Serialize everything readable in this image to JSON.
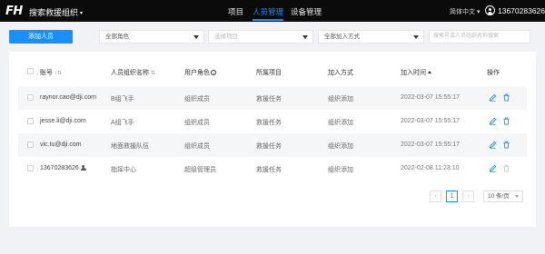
{
  "header": {
    "logo": "FH",
    "org_name": "搜索救援组织",
    "org_caret": "▾",
    "nav": [
      {
        "label": "项目",
        "active": false
      },
      {
        "label": "人员管理",
        "active": true
      },
      {
        "label": "设备管理",
        "active": false
      }
    ],
    "language": "简体中文 ▾",
    "user_phone": "13670283626"
  },
  "toolbar": {
    "add_button": "添加人员",
    "role_select": "全部角色",
    "project_select_placeholder": "选择项目",
    "join_method_select": "全部加入方式",
    "search_placeholder": "搜索号或人员组织名称搜索"
  },
  "table": {
    "columns": {
      "account": "账号",
      "account_sort": "↓⇅",
      "org_name": "人员组织名称",
      "org_sort": "⇅",
      "user_role": "用户角色",
      "info_mark": "i",
      "project": "所属项目",
      "join_method": "加入方式",
      "join_time": "加入时间",
      "actions": "操作"
    },
    "rows": [
      {
        "account": "raynor.cao@dji.com",
        "org": "B组飞手",
        "role": "组织成员",
        "project": "救援任务",
        "method": "组织添加",
        "time": "2022-03-07 15:55:17",
        "is_admin": false
      },
      {
        "account": "jesse.li@dji.com",
        "org": "A组飞手",
        "role": "组织成员",
        "project": "救援任务",
        "method": "组织添加",
        "time": "2022-03-07 15:55:17",
        "is_admin": false
      },
      {
        "account": "vic.tu@dji.com",
        "org": "地面救援队伍",
        "role": "组织成员",
        "project": "救援任务",
        "method": "组织添加",
        "time": "2022-03-07 15:55:17",
        "is_admin": false
      },
      {
        "account": "13670283626",
        "org": "指挥中心",
        "role": "超级管理员",
        "project": "救援任务",
        "method": "组织添加",
        "time": "2022-02-08 11:23:10",
        "is_admin": true
      }
    ]
  },
  "pagination": {
    "prev": "‹",
    "current_page": "1",
    "next": "›",
    "page_size": "10 条/页"
  },
  "colors": {
    "accent": "#1890ff",
    "delete": "#1890ff",
    "disabled": "#c8c8c8"
  }
}
